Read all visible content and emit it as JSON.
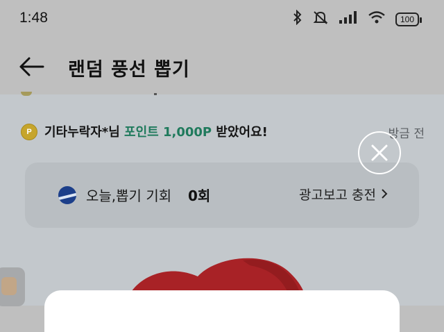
{
  "status_bar": {
    "time": "1:48",
    "battery": "100",
    "icons": [
      "bluetooth-icon",
      "mute-icon",
      "signal-icon",
      "wifi-icon",
      "battery-icon"
    ]
  },
  "app_bar": {
    "title": "랜덤 풍선 뽑기"
  },
  "notice": {
    "coin_letter": "P",
    "user": "기타누락자*님 ",
    "points": "포인트 1,000P",
    "suffix": " 받았어요!",
    "time": "방금 전"
  },
  "ticket": {
    "label": "오늘,뽑기 기회",
    "count": "0회",
    "charge_label": "광고보고 충전"
  },
  "colors": {
    "points_green": "#1f7a5c",
    "balloon_red": "#b3262a",
    "coin_gold": "#c6a52c",
    "overlay_gray": "#bfbfbf"
  }
}
